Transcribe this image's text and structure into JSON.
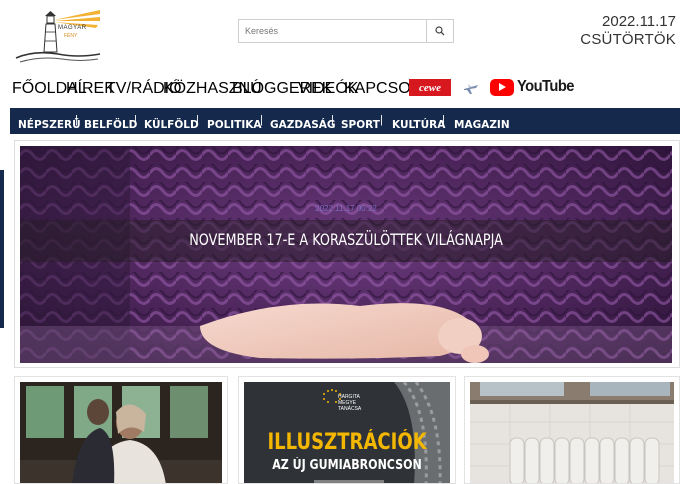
{
  "header": {
    "logo_text_1": "MAGYAR",
    "logo_text_2": "FÉNY",
    "search_placeholder": "Keresés",
    "date": "2022.11.17",
    "weekday": "CSÜTÖRTÖK"
  },
  "main_nav": {
    "items": [
      "FŐOLDAL",
      "HÍREK",
      "TV/RÁDIÓ",
      "KÖZHASZNÚ",
      "BLOGGEREK",
      "VIDEÓK",
      "KAPCSOLAT"
    ],
    "cewe": "cewe",
    "youtube": "YouTube"
  },
  "category_nav": {
    "items": [
      "NÉPSZERŰ",
      "BELFÖLD",
      "KÜLFÖLD",
      "POLITIKA",
      "GAZDASÁG",
      "SPORT",
      "KULTÚRA",
      "MAGAZIN"
    ],
    "separator": "|"
  },
  "hero": {
    "date": "2022.11.17 00:22",
    "title": "NOVEMBER 17-E A KORASZÜLÖTTEK VILÁGNAPJA"
  },
  "cards": {
    "ad": {
      "org_1": "HARGITA",
      "org_2": "MEGYE",
      "org_3": "TANÁCSA",
      "title": "ILLUSZTRÁCIÓK",
      "subtitle": "AZ ÚJ GUMIABRONCSON"
    }
  },
  "colors": {
    "nav_bg": "#14294b",
    "cewe_red": "#d7191f",
    "youtube_red": "#ff0000",
    "ad_yellow": "#f4b700"
  }
}
